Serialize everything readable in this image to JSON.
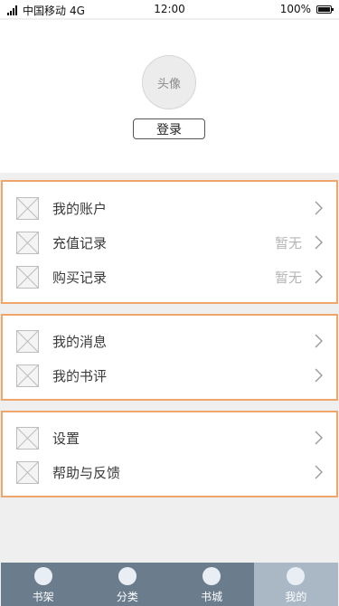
{
  "status_bar": {
    "carrier": "中国移动",
    "network": "4G",
    "time": "12:00",
    "battery": "100%"
  },
  "profile": {
    "avatar_text": "头像",
    "login_label": "登录"
  },
  "groups": [
    {
      "items": [
        {
          "label": "我的账户",
          "value": ""
        },
        {
          "label": "充值记录",
          "value": "暂无"
        },
        {
          "label": "购买记录",
          "value": "暂无"
        }
      ]
    },
    {
      "items": [
        {
          "label": "我的消息",
          "value": ""
        },
        {
          "label": "我的书评",
          "value": ""
        }
      ]
    },
    {
      "items": [
        {
          "label": "设置",
          "value": ""
        },
        {
          "label": "帮助与反馈",
          "value": ""
        }
      ]
    }
  ],
  "tabbar": {
    "tabs": [
      {
        "label": "书架"
      },
      {
        "label": "分类"
      },
      {
        "label": "书城"
      },
      {
        "label": "我的",
        "active": true
      }
    ]
  },
  "colors": {
    "group_border": "#f0a56b",
    "tabbar_bg": "#6b7d8d",
    "tab_active_bg": "#aab8c6",
    "value_text": "#b5b5b5"
  },
  "icons": {
    "row_icon": "placeholder-x-icon",
    "row_chevron": "chevron-right-icon",
    "tab_icon": "circle-icon"
  }
}
